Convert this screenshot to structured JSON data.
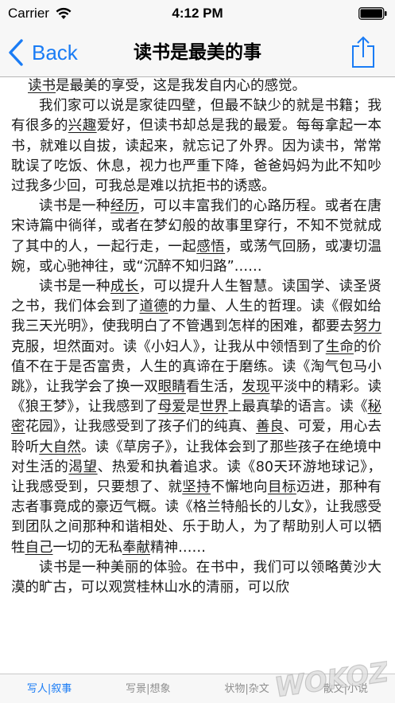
{
  "status_bar": {
    "carrier": "Carrier",
    "time": "4:12 PM",
    "wifi_icon": "wifi-icon",
    "battery_icon": "battery-icon"
  },
  "nav": {
    "back_label": "Back",
    "title": "读书是最美的事",
    "share_icon": "share-icon",
    "accent_color": "#1a7cf5"
  },
  "article": {
    "paragraphs": [
      [
        {
          "t": "读书",
          "u": true
        },
        {
          "t": "是最美的享受，这是我发自内心的感觉。"
        }
      ],
      [
        {
          "t": "我们家可以说是家徒四壁，但最不缺少的就是书籍；我有很多的"
        },
        {
          "t": "兴趣",
          "u": true
        },
        {
          "t": "爱好，但读书却总是我的最爱。每每拿起一本书，就难以自拔，读起来，就忘记了外界。因为读书，常常耽误了吃饭、休息，视力也严重下降，爸爸妈妈为此不知吵过我多少回，可我总是难以抗拒书的诱惑。"
        }
      ],
      [
        {
          "t": "读书是一种"
        },
        {
          "t": "经历",
          "u": true
        },
        {
          "t": "，可以丰富我们的心路历程。或者在唐宋诗篇中徜徉，或者在梦幻般的故事里穿行，不知不觉就成了其中的人，一起行走，一起"
        },
        {
          "t": "感悟",
          "u": true
        },
        {
          "t": "，或荡气回肠，或凄切温婉，或心驰神往，或“沉醉不知归路”……"
        }
      ],
      [
        {
          "t": "读书是一种"
        },
        {
          "t": "成长",
          "u": true
        },
        {
          "t": "，可以提升人生智慧。读国学、读圣贤之书，我们体会到了"
        },
        {
          "t": "道德",
          "u": true
        },
        {
          "t": "的力量、人生的哲理。读《假如给我三天光明》，使我明白了不管遇到怎样的困难，都要去"
        },
        {
          "t": "努力",
          "u": true
        },
        {
          "t": "克服，坦然面对。读《小妇人》，让我从中领悟到了"
        },
        {
          "t": "生命",
          "u": true
        },
        {
          "t": "的价值不在于是否富贵，人生的真谛在于磨练。读《淘气包马小跳》，让我学会了换一双"
        },
        {
          "t": "眼睛",
          "u": true
        },
        {
          "t": "看生活，"
        },
        {
          "t": "发现",
          "u": true
        },
        {
          "t": "平淡中的精彩。读《狼王梦》，让我感到了"
        },
        {
          "t": "母爱",
          "u": true
        },
        {
          "t": "是"
        },
        {
          "t": "世界",
          "u": true
        },
        {
          "t": "上最真挚的语言。读《"
        },
        {
          "t": "秘密",
          "u": true
        },
        {
          "t": "花园》，让我感受到了孩子们的纯真、"
        },
        {
          "t": "善良",
          "u": true
        },
        {
          "t": "、可爱，用心去聆听"
        },
        {
          "t": "大自然",
          "u": true
        },
        {
          "t": "。读《草房子》，让我体会到了那些孩子在绝境中对生活的"
        },
        {
          "t": "渴望",
          "u": true
        },
        {
          "t": "、热爱和执着追求。读《80天环游地球记》，让我感受到，只要想了、就"
        },
        {
          "t": "坚持",
          "u": true
        },
        {
          "t": "不懈地向"
        },
        {
          "t": "目标",
          "u": true
        },
        {
          "t": "迈进，那种有志者事竟成的豪迈气概。读《格兰特船长的儿女》，让我感受到团队之间那种和谐相处、乐于助人，为了帮助别人可以牺牲"
        },
        {
          "t": "自己",
          "u": true
        },
        {
          "t": "一切的无私"
        },
        {
          "t": "奉献",
          "u": true
        },
        {
          "t": "精神……"
        }
      ],
      [
        {
          "t": "读书是一种美丽的体验。在书中，我们可以领略黄沙大漠的旷古，可以观赏桂林山水的清丽，可以欣"
        }
      ]
    ]
  },
  "tabs": [
    {
      "label": "写人|叙事",
      "active": true
    },
    {
      "label": "写景|想象",
      "active": false
    },
    {
      "label": "状物|杂文",
      "active": false
    },
    {
      "label": "散文|小说",
      "active": false
    }
  ],
  "watermark": {
    "text": "WOKOZ"
  }
}
